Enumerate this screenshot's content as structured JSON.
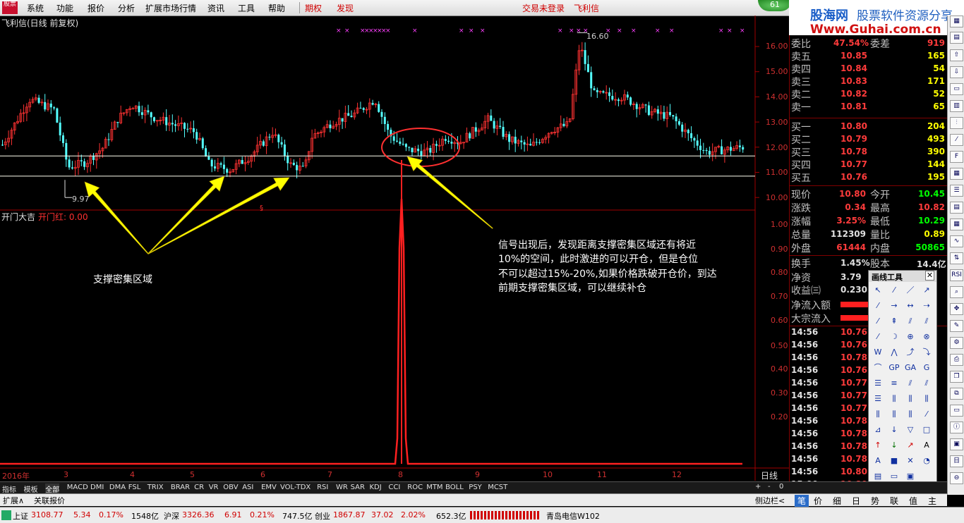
{
  "menu": {
    "items": [
      "系统",
      "功能",
      "报价",
      "分析",
      "扩展市场行情",
      "资讯",
      "工具",
      "帮助"
    ],
    "qiquan": "期权",
    "faxian": "发现",
    "login": "交易未登录",
    "stock_name": "飞利信"
  },
  "logo_text": "股票",
  "badge": "61",
  "brand": {
    "name": "股海网",
    "slogan": "股票软件资源分享",
    "url": "Www.Guhai.com.cn"
  },
  "chart": {
    "title": "飞利信(日线 前复权)",
    "high_label": "16.60",
    "low_label": "9.97",
    "year_label": "2016年",
    "period": "日线",
    "price_ticks": [
      "16.00",
      "15.00",
      "14.00",
      "13.00",
      "12.00",
      "11.00",
      "10.00"
    ],
    "month_ticks": [
      "3",
      "4",
      "5",
      "6",
      "7",
      "8",
      "9",
      "10",
      "11",
      "12"
    ]
  },
  "indicator": {
    "name": "开门大吉",
    "value_label": "开门红: 0.00",
    "ticks": [
      "1.00",
      "0.90",
      "0.80",
      "0.70",
      "0.60",
      "0.50",
      "0.40",
      "0.30",
      "0.20"
    ]
  },
  "annotations": {
    "support": "支撑密集区域",
    "signal_lines": [
      "信号出现后，发现距离支撑密集区域还有将近",
      "10%的空间，此时激进的可以开仓，但是仓位",
      "不可以超过15%-20%,如果价格跌破开仓价，到达",
      "前期支撑密集区域，可以继续补仓"
    ]
  },
  "quote": {
    "weibi_label": "委比",
    "weibi_value": "47.54%",
    "weicha_label": "委差",
    "weicha_value": "919",
    "asks": [
      {
        "label": "卖五",
        "price": "10.85",
        "vol": "165"
      },
      {
        "label": "卖四",
        "price": "10.84",
        "vol": "54"
      },
      {
        "label": "卖三",
        "price": "10.83",
        "vol": "171"
      },
      {
        "label": "卖二",
        "price": "10.82",
        "vol": "52"
      },
      {
        "label": "卖一",
        "price": "10.81",
        "vol": "65"
      }
    ],
    "bids": [
      {
        "label": "买一",
        "price": "10.80",
        "vol": "204"
      },
      {
        "label": "买二",
        "price": "10.79",
        "vol": "493"
      },
      {
        "label": "买三",
        "price": "10.78",
        "vol": "390"
      },
      {
        "label": "买四",
        "price": "10.77",
        "vol": "144"
      },
      {
        "label": "买五",
        "price": "10.76",
        "vol": "195"
      }
    ],
    "stats": [
      {
        "l1": "现价",
        "v1": "10.80",
        "l2": "今开",
        "v2": "10.45",
        "c1": "red",
        "c2": "grn"
      },
      {
        "l1": "涨跌",
        "v1": "0.34",
        "l2": "最高",
        "v2": "10.82",
        "c1": "red",
        "c2": "red"
      },
      {
        "l1": "涨幅",
        "v1": "3.25%",
        "l2": "最低",
        "v2": "10.29",
        "c1": "red",
        "c2": "grn"
      },
      {
        "l1": "总量",
        "v1": "112309",
        "l2": "量比",
        "v2": "0.89",
        "c1": "wht",
        "c2": "yel"
      },
      {
        "l1": "外盘",
        "v1": "61444",
        "l2": "内盘",
        "v2": "50865",
        "c1": "red",
        "c2": "grn"
      }
    ],
    "huanshou_label": "换手",
    "huanshou": "1.45%",
    "guben_label": "股本",
    "guben": "14.4亿",
    "jingzi_label": "净资",
    "jingzi": "3.79",
    "shouyi_label": "收益㈢",
    "shouyi": "0.230",
    "netflow_label": "净流入额",
    "dazong_label": "大宗流入",
    "ticks": [
      {
        "t": "14:56",
        "p": "10.76"
      },
      {
        "t": "14:56",
        "p": "10.76"
      },
      {
        "t": "14:56",
        "p": "10.78"
      },
      {
        "t": "14:56",
        "p": "10.76"
      },
      {
        "t": "14:56",
        "p": "10.77"
      },
      {
        "t": "14:56",
        "p": "10.77"
      },
      {
        "t": "14:56",
        "p": "10.77"
      },
      {
        "t": "14:56",
        "p": "10.78"
      },
      {
        "t": "14:56",
        "p": "10.78"
      },
      {
        "t": "14:56",
        "p": "10.78"
      },
      {
        "t": "14:56",
        "p": "10.78"
      },
      {
        "t": "14:56",
        "p": "10.80"
      },
      {
        "t": "15:00",
        "p": "10.80"
      }
    ]
  },
  "drawtools": {
    "title": "画线工具"
  },
  "tabs": [
    "指标",
    "模板",
    "全部",
    "MACD",
    "DMI",
    "DMA",
    "FSL",
    "TRIX",
    "BRAR",
    "CR",
    "VR",
    "OBV",
    "ASI",
    "EMV",
    "VOL-TDX",
    "RSI",
    "WR",
    "SAR",
    "KDJ",
    "CCI",
    "ROC",
    "MTM",
    "BOLL",
    "PSY",
    "MCST"
  ],
  "bottom": {
    "kuozhan": "扩展∧",
    "guanlian": "关联报价",
    "cebianlan": "侧边栏<",
    "tabs": [
      "笔",
      "价",
      "细",
      "日",
      "势",
      "联",
      "值",
      "主"
    ]
  },
  "status": {
    "sh_label": "上证",
    "sh_val": "3108.77",
    "sh_chg": "5.34",
    "sh_pct": "0.17%",
    "sh_amt": "1548亿",
    "hs_label": "沪深",
    "hs_val": "3326.36",
    "hs_chg": "6.91",
    "hs_pct": "0.21%",
    "hs_amt": "747.5亿",
    "cy_label": "创业",
    "cy_val": "1867.87",
    "cy_chg": "37.02",
    "cy_pct": "2.02%",
    "cy_amt": "652.3亿",
    "server": "青岛电信W102"
  }
}
